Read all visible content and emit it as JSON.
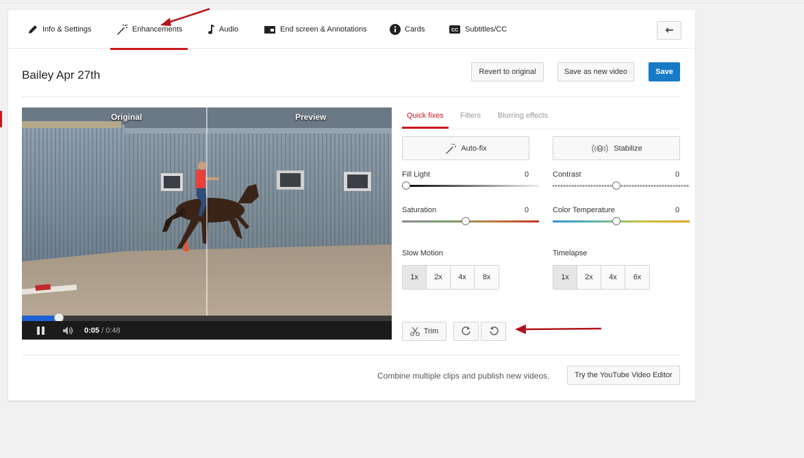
{
  "tabs": [
    {
      "label": "Info & Settings",
      "icon": "pencil-icon"
    },
    {
      "label": "Enhancements",
      "icon": "magic-wand-icon"
    },
    {
      "label": "Audio",
      "icon": "music-note-icon"
    },
    {
      "label": "End screen & Annotations",
      "icon": "end-screen-icon"
    },
    {
      "label": "Cards",
      "icon": "info-circle-icon"
    },
    {
      "label": "Subtitles/CC",
      "icon": "cc-icon"
    }
  ],
  "active_tab": "Enhancements",
  "video_title": "Bailey Apr 27th",
  "header_buttons": {
    "revert": "Revert to original",
    "save_new": "Save as new video",
    "save": "Save"
  },
  "player": {
    "original_label": "Original",
    "preview_label": "Preview",
    "current_time": "0:05",
    "duration": "/ 0:48",
    "progress_fraction": 0.1
  },
  "panel_tabs": [
    "Quick fixes",
    "Filters",
    "Blurring effects"
  ],
  "quick_fix_buttons": {
    "autofix": "Auto-fix",
    "stabilize": "Stabilize"
  },
  "sliders": [
    {
      "label": "Fill Light",
      "value": "0"
    },
    {
      "label": "Contrast",
      "value": "0"
    },
    {
      "label": "Saturation",
      "value": "0"
    },
    {
      "label": "Color Temperature",
      "value": "0"
    }
  ],
  "slow_motion": {
    "label": "Slow Motion",
    "options": [
      "1x",
      "2x",
      "4x",
      "8x"
    ],
    "selected": "1x"
  },
  "timelapse": {
    "label": "Timelapse",
    "options": [
      "1x",
      "2x",
      "4x",
      "6x"
    ],
    "selected": "1x"
  },
  "trim_label": "Trim",
  "footer": {
    "text": "Combine multiple clips and publish new videos.",
    "button": "Try the YouTube Video Editor"
  },
  "colors": {
    "accent_red": "#cc181e",
    "save_blue": "#167ac6",
    "progress_blue": "#1c62d6"
  }
}
